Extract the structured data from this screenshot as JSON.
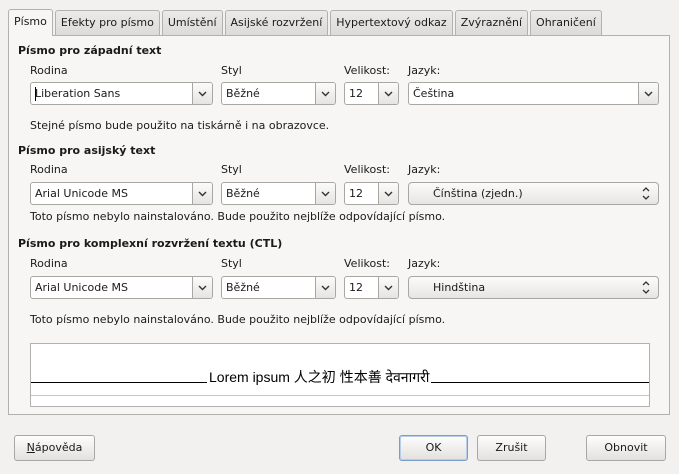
{
  "tabs": [
    {
      "label": "Písmo",
      "active": true
    },
    {
      "label": "Efekty pro písmo"
    },
    {
      "label": "Umístění"
    },
    {
      "label": "Asijské rozvržení"
    },
    {
      "label": "Hypertextový odkaz"
    },
    {
      "label": "Zvýraznění"
    },
    {
      "label": "Ohraničení"
    }
  ],
  "western": {
    "title": "Písmo pro západní text",
    "family_label": "Rodina",
    "style_label": "Styl",
    "size_label": "Velikost:",
    "lang_label": "Jazyk:",
    "family": "Liberation Sans",
    "style": "Běžné",
    "size": "12",
    "language": "Čeština",
    "note": "Stejné písmo bude použito na tiskárně i na obrazovce."
  },
  "asian": {
    "title": "Písmo pro asijský text",
    "family_label": "Rodina",
    "style_label": "Styl",
    "size_label": "Velikost:",
    "lang_label": "Jazyk:",
    "family": "Arial Unicode MS",
    "style": "Běžné",
    "size": "12",
    "language": "Čínština (zjedn.)",
    "note": "Toto písmo nebylo nainstalováno. Bude použito nejblíže odpovídající písmo."
  },
  "ctl": {
    "title": "Písmo pro komplexní rozvržení textu (CTL)",
    "family_label": "Rodina",
    "style_label": "Styl",
    "size_label": "Velikost:",
    "lang_label": "Jazyk:",
    "family": "Arial Unicode MS",
    "style": "Běžné",
    "size": "12",
    "language": "Hindština",
    "note": "Toto písmo nebylo nainstalováno. Bude použito nejblíže odpovídající písmo."
  },
  "preview": {
    "text": "Lorem ipsum   人之初 性本善   देवनागरी"
  },
  "buttons": {
    "help": "Nápověda",
    "ok": "OK",
    "cancel": "Zrušit",
    "reset": "Obnovit"
  }
}
